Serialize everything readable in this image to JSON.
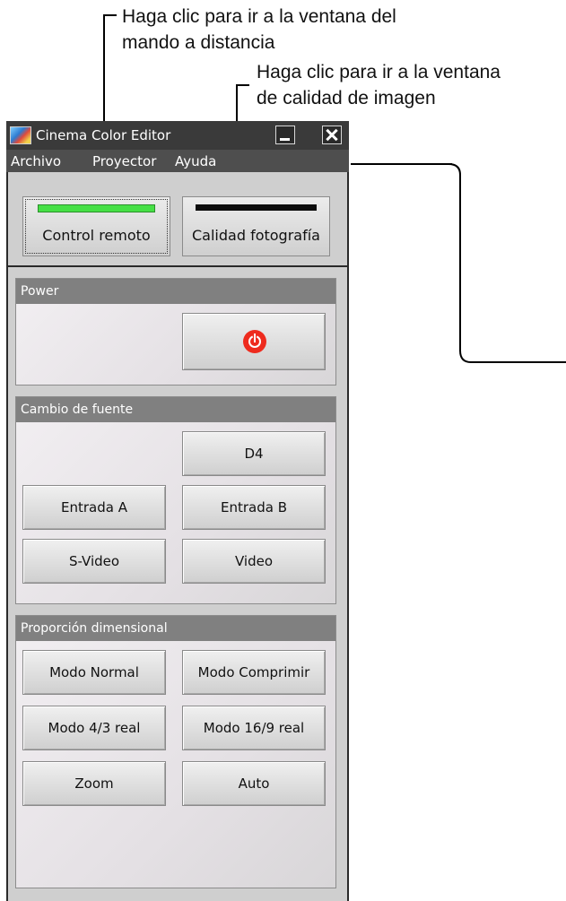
{
  "annotations": {
    "remote_window_note": [
      "Haga clic para ir a la ventana del",
      "mando a distancia"
    ],
    "quality_window_note": [
      "Haga clic para ir a la ventana",
      "de calidad de imagen"
    ]
  },
  "window": {
    "title": "Cinema Color Editor",
    "menu": [
      "Archivo",
      "Proyector",
      "Ayuda"
    ]
  },
  "mode_buttons": {
    "remote": "Control remoto",
    "quality": "Calidad fotografía"
  },
  "indicator_colors": {
    "remote": "#46e046",
    "quality": "#0c0c0c"
  },
  "power_panel": {
    "title": "Power",
    "power_icon_color": "#ee2b1e"
  },
  "source_panel": {
    "title": "Cambio de fuente",
    "buttons": [
      "D4",
      "Entrada A",
      "Entrada B",
      "S-Video",
      "Video"
    ]
  },
  "aspect_panel": {
    "title": "Proporción dimensional",
    "buttons": [
      "Modo Normal",
      "Modo Comprimir",
      "Modo 4/3 real",
      "Modo 16/9 real",
      "Zoom",
      "Auto"
    ]
  }
}
